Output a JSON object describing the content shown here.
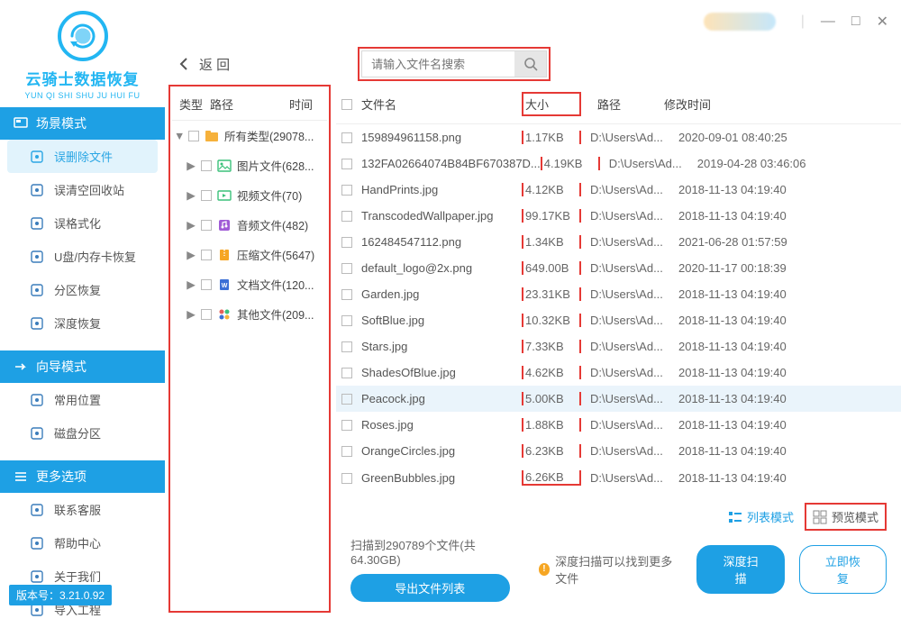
{
  "colors": {
    "accent": "#1ea0e4",
    "highlight_border": "#e53935",
    "row_hover": "#eaf4fb"
  },
  "window": {
    "controls": [
      "—",
      "□",
      "✕"
    ]
  },
  "brand": {
    "name": "云骑士数据恢复",
    "pinyin": "YUN QI SHI SHU JU HUI FU"
  },
  "sidebar": {
    "sections": [
      {
        "header": "场景模式",
        "items": [
          {
            "label": "误删除文件",
            "active": true
          },
          {
            "label": "误清空回收站"
          },
          {
            "label": "误格式化"
          },
          {
            "label": "U盘/内存卡恢复"
          },
          {
            "label": "分区恢复"
          },
          {
            "label": "深度恢复"
          }
        ]
      },
      {
        "header": "向导模式",
        "items": [
          {
            "label": "常用位置"
          },
          {
            "label": "磁盘分区"
          }
        ]
      },
      {
        "header": "更多选项",
        "items": [
          {
            "label": "联系客服"
          },
          {
            "label": "帮助中心"
          },
          {
            "label": "关于我们"
          },
          {
            "label": "导入工程"
          }
        ]
      }
    ],
    "version": "版本号：3.21.0.92"
  },
  "toolbar": {
    "back": "返  回",
    "search_placeholder": "请输入文件名搜索"
  },
  "tree": {
    "headers": [
      "类型",
      "路径",
      "时间"
    ],
    "rows": [
      {
        "expand": "▼",
        "icon": "folder",
        "color": "#f6b13b",
        "text": "所有类型(29078..."
      },
      {
        "expand": "▶",
        "lvl": 1,
        "icon": "image",
        "color": "#3bc17a",
        "text": "图片文件(628..."
      },
      {
        "expand": "▶",
        "lvl": 1,
        "icon": "video",
        "color": "#3bc17a",
        "text": "视频文件(70)"
      },
      {
        "expand": "▶",
        "lvl": 1,
        "icon": "audio",
        "color": "#a05bd6",
        "text": "音频文件(482)"
      },
      {
        "expand": "▶",
        "lvl": 1,
        "icon": "zip",
        "color": "#f6a623",
        "text": "压缩文件(5647)"
      },
      {
        "expand": "▶",
        "lvl": 1,
        "icon": "doc",
        "color": "#3b6fd6",
        "text": "文档文件(120..."
      },
      {
        "expand": "▶",
        "lvl": 1,
        "icon": "other",
        "color": "#e5615b",
        "text": "其他文件(209..."
      }
    ]
  },
  "filelist": {
    "headers": {
      "name": "文件名",
      "size": "大小",
      "path": "路径",
      "time": "修改时间"
    },
    "rows": [
      {
        "name": "159894961158.png",
        "size": "1.17KB",
        "path": "D:\\Users\\Ad...",
        "time": "2020-09-01 08:40:25"
      },
      {
        "name": "132FA02664074B84BF670387D...",
        "size": "4.19KB",
        "path": "D:\\Users\\Ad...",
        "time": "2019-04-28 03:46:06"
      },
      {
        "name": "HandPrints.jpg",
        "size": "4.12KB",
        "path": "D:\\Users\\Ad...",
        "time": "2018-11-13 04:19:40"
      },
      {
        "name": "TranscodedWallpaper.jpg",
        "size": "99.17KB",
        "path": "D:\\Users\\Ad...",
        "time": "2018-11-13 04:19:40"
      },
      {
        "name": "162484547112.png",
        "size": "1.34KB",
        "path": "D:\\Users\\Ad...",
        "time": "2021-06-28 01:57:59"
      },
      {
        "name": "default_logo@2x.png",
        "size": "649.00B",
        "path": "D:\\Users\\Ad...",
        "time": "2020-11-17 00:18:39"
      },
      {
        "name": "Garden.jpg",
        "size": "23.31KB",
        "path": "D:\\Users\\Ad...",
        "time": "2018-11-13 04:19:40"
      },
      {
        "name": "SoftBlue.jpg",
        "size": "10.32KB",
        "path": "D:\\Users\\Ad...",
        "time": "2018-11-13 04:19:40"
      },
      {
        "name": "Stars.jpg",
        "size": "7.33KB",
        "path": "D:\\Users\\Ad...",
        "time": "2018-11-13 04:19:40"
      },
      {
        "name": "ShadesOfBlue.jpg",
        "size": "4.62KB",
        "path": "D:\\Users\\Ad...",
        "time": "2018-11-13 04:19:40"
      },
      {
        "name": "Peacock.jpg",
        "size": "5.00KB",
        "path": "D:\\Users\\Ad...",
        "time": "2018-11-13 04:19:40",
        "active": true
      },
      {
        "name": "Roses.jpg",
        "size": "1.88KB",
        "path": "D:\\Users\\Ad...",
        "time": "2018-11-13 04:19:40"
      },
      {
        "name": "OrangeCircles.jpg",
        "size": "6.23KB",
        "path": "D:\\Users\\Ad...",
        "time": "2018-11-13 04:19:40"
      },
      {
        "name": "GreenBubbles.jpg",
        "size": "6.26KB",
        "path": "D:\\Users\\Ad...",
        "time": "2018-11-13 04:19:40"
      }
    ]
  },
  "modes": {
    "list": "列表模式",
    "preview": "预览模式"
  },
  "footer": {
    "scan_info": "扫描到290789个文件(共64.30GB)",
    "export": "导出文件列表",
    "hint": "深度扫描可以找到更多文件",
    "deep": "深度扫描",
    "recover": "立即恢复"
  }
}
